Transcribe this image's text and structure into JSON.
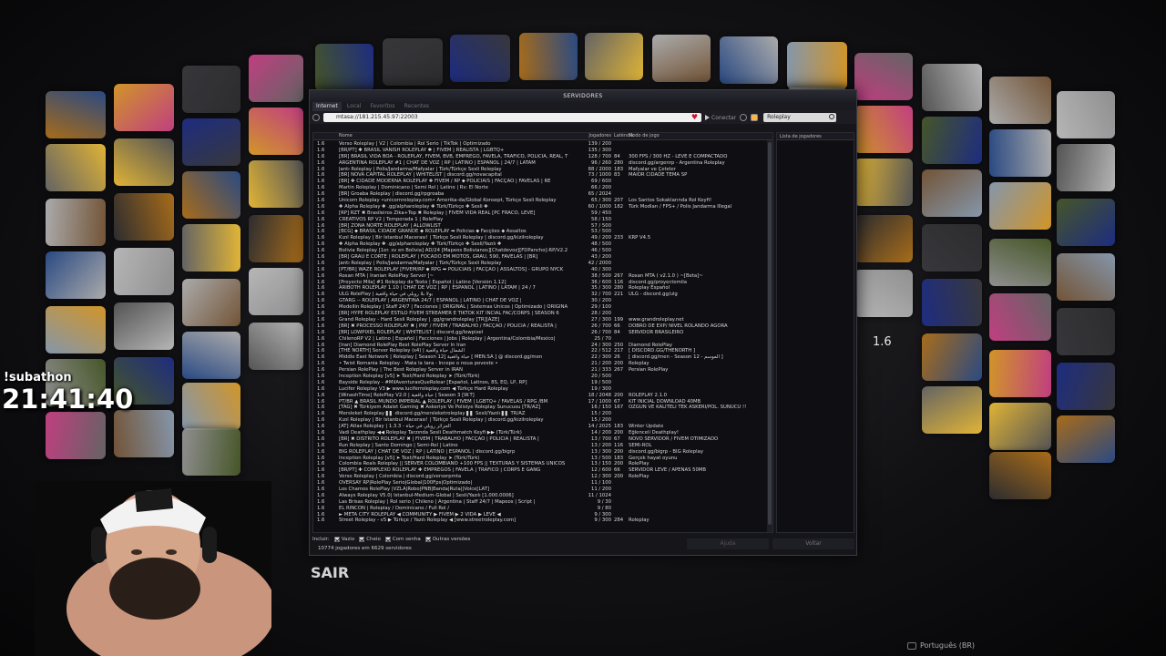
{
  "overlay": {
    "sub_label": "!subathon",
    "clock": "21:41:40",
    "exit_label": "SAIR",
    "side_version": "1.6",
    "language": "Português (BR)"
  },
  "window": {
    "title": "SERVIDORES",
    "tabs": [
      "Internet",
      "Local",
      "Favoritos",
      "Recentes"
    ],
    "address": "mtasa://181.215.45.97:22003",
    "connect_label": "Conectar",
    "search_value": "Roleplay",
    "columns": {
      "version": "",
      "name": "Nome",
      "players": "Jogadores",
      "latency": "Latência",
      "mode": "Modo de jogo"
    },
    "players_header": "Lista de jogadores",
    "filters_label": "Incluir:",
    "filters": [
      "Vazio",
      "Cheio",
      "Com senha",
      "Outras versões"
    ],
    "totals": "10774 jogadores em 6629 servidores",
    "help_label": "Ajuda",
    "back_label": "Voltar"
  },
  "servers": [
    [
      "1.6",
      "Verso Roleplay | V2 | Colombia | Rol Serio | TikTok | Optimizado",
      "139 / 200",
      "",
      ""
    ],
    [
      "1.6",
      "[BR/PT] ✱ BRASIL VANISH ROLEPLAY ✱ | FIVEM | REALISTA | LGBTQ+",
      "135 / 300",
      "",
      ""
    ],
    [
      "1.6",
      "[BR] BRASIL VIDA BOA - ROLEPLAY, FIVEM, BVB, EMPREGO, FAVELA, TRAFICO, POLICIA, REAL, T",
      "128 / 700",
      "84",
      "300 FPS / 300 HZ - LEVE E COMPACTADO"
    ],
    [
      "1.6",
      "ARGENTINA ROLEPLAY #1 | CHAT DE VOZ | RP | LATINO | ESPAÑOL | 24/7 | LATAM",
      "96 / 260",
      "280",
      "discord.gg/argenrp - Argentina Roleplay"
    ],
    [
      "1.6",
      "Jantı Roleplay | Polis/Jandarma/Mafyalar | Türk/Türkçe Sesli Roleplay",
      "88 / 2000",
      "183",
      "Mafyalar ve Çeteler"
    ],
    [
      "1.6",
      "[BR] NOVA CAPITAL ROLEPLAY | WHITELIST | discord.gg/novacapital",
      "73 / 1000",
      "83",
      "MAIOR CIDADE TEMA SP"
    ],
    [
      "1.6",
      "[BR] ✚ CIDADE MODERNA ROLEPLAY ✚ FIVEM / RP ⬥ POLICIAIS | FACÇÃO | FAVELAS | RE",
      "69 / 600",
      "",
      ""
    ],
    [
      "1.6",
      "Martin Roleplay | Dominicano | Semi Rol | Latino | Rv: El Norte",
      "66 / 200",
      "",
      ""
    ],
    [
      "1.6",
      "[BR] Groaba Roleplay | discord.gg/rpgroaba",
      "65 / 2024",
      "",
      ""
    ],
    [
      "1.6",
      "Unicorn Roleplay •unicornroleplay.com• Amerika-da/Global Konsept, Türkçe Sesli Roleplay",
      "65 / 300",
      "207",
      "Los Santos Sokaklarında Rol Keyfi!"
    ],
    [
      "1.6",
      "✚ Alpha Roleplay ✚ .gg/alpharoleplay ✚ Türk/Türkçe ✚ Sesli ✚",
      "60 / 1000",
      "182",
      "Türk Modları / FPS+ / Polis Jandarma İllegal"
    ],
    [
      "1.6",
      "[RP] RZT ✖ Brasileiros Zika+Top ✖ Roleplay | FIVEM VIDA REAL [PC FRACO, LEVE]",
      "59 / 450",
      "",
      ""
    ],
    [
      "1.6",
      "CREATIVOS RP V2 | Temporada 1 | RolePlay",
      "58 / 150",
      "",
      ""
    ],
    [
      "1.6",
      "[BR] ZONA NORTE ROLEPLAY | ALLOWLIST",
      "57 / 500",
      "",
      ""
    ],
    [
      "1.6",
      "[BCG] ⬥ BRASIL CIDADE GRANDE ⬥ ROLEPLAY ➡ Policias ⬥ Facções ⬥ Assaltos",
      "53 / 500",
      "",
      ""
    ],
    [
      "1.6",
      "Kızıl Roleplay | Bir İstanbul Macerası! | Türkçe Sesli Roleplay | discord.gg/kizilroleplay",
      "49 / 200",
      "233",
      "KRP V4.5"
    ],
    [
      "1.6",
      "✚ Alpha Roleplay ✚ .gg/alpharoleplay ✚ Türk/Türkçe ✚ Sesli/Yazılı ✚",
      "48 / 500",
      "",
      ""
    ],
    [
      "1.6",
      "Bolivia Roleplay [1er. sv en Bolivia] AD/24 [Mapeos Bolivianos][Chatdevoz][FDPancho]-RP/V2.2",
      "46 / 500",
      "",
      ""
    ],
    [
      "1.6",
      "[BR] GRAU E CORTE | ROLEPLAY | FOCADO EM MOTOS, GRAU, 590, FAVELAS | [BR]",
      "43 / 200",
      "",
      ""
    ],
    [
      "1.6",
      "Jantı Roleplay | Polis/Jandarma/Mafyalar | Türk/Türkçe Sesli Roleplay",
      "42 / 2000",
      "",
      ""
    ],
    [
      "1.6",
      "[PT/BR] WAZE ROLEPLAY [FIVEM/RP ⬥ RPG ➡ POLICIAIS | FACÇÃO | ASSALTOS] - GRUPO NYCK",
      "40 / 300",
      "",
      ""
    ],
    [
      "1.6",
      "Roxan MTA | Iranian RolePlay Server ]~",
      "38 / 500",
      "267",
      "Roxan MTA ( v2.1.0 ) ~[Beta]~"
    ],
    [
      "1.6",
      "[Proyecto Mila] #1 Roleplay de Texto | Español | Latino [Versión 1.12]",
      "36 / 600",
      "116",
      "discord.gg/proyectomila"
    ],
    [
      "1.6",
      "ARIBOTH ROLEPLAY 1.10 | CHAT DE VOZ | RP | ESPAÑOL | LATINO | LATAM | 24 / 7",
      "35 / 300",
      "280",
      "Roleplay Español"
    ],
    [
      "1.6",
      "ULG RolePlay | يولا بلا رويلي في حياة واقعية",
      "32 / 700",
      "221",
      "ULG - discord.gg/ulg"
    ],
    [
      "1.6",
      "GTARG -- ROLEPLAY | ARGENTINA 24/7 | ESPAÑOL | LATINO | CHAT DE VOZ |",
      "30 / 200",
      "",
      ""
    ],
    [
      "1.6",
      "Medellin Roleplay | Staff 24/7 | Facciones | ORIGINAL | Sistemas Unicos | Optimizado | ORIGINA",
      "29 / 100",
      "",
      ""
    ],
    [
      "1.6",
      "[BR] HYPE ROLEPLAY ESTILO FIVEM STREAMER E TIKTOK KIT INCIAL FAC/CORPS | SEASON 6",
      "28 / 200",
      "",
      ""
    ],
    [
      "1.6",
      "Grand Roleplay - Hard Sesli Roleplay | .gg/grandroleplay [TR][AZE]",
      "27 / 300",
      "199",
      "www.grandroleplay.net"
    ],
    [
      "1.6",
      "[BR] ✖ PROCESSO ROLEPLAY ✖ | PRF / FIVEM / TRABALHO / FACÇÃO / POLICIA / REALISTA |",
      "26 / 700",
      "66",
      "DOBRO DE EXP/ NIVEL ROLANDO AGORA"
    ],
    [
      "1.6",
      "[BR] LOWPIXEL ROLEPLAY | WHITELIST | discord.gg/lowpixel",
      "26 / 700",
      "84",
      "SERVIDOR BRASILEIRO"
    ],
    [
      "1.6",
      "ChilenoRP V2 | Latino | Español | Facciones | Jobs | Roleplay | Argentina/Colombia/Mexico|",
      "25 / 70",
      "",
      ""
    ],
    [
      "1.6",
      "[Iran] Diamond RolePlay Best RolePlay Server In Iran",
      "24 / 300",
      "250",
      "Diamond RolePlay"
    ],
    [
      "1.6",
      "[THE NORTH] Server Roleplay (s4) | الشمال حياة واقعية",
      "22 / 512",
      "217",
      "[ DISCORD.GG/THENORTH ]"
    ],
    [
      "1.6",
      "Middle East Network | Roleplay [ Season 12] حياة واقعية [ MEN.SA ] @ discord.gg/men",
      "22 / 300",
      "26",
      "[ discord.gg/men - Season 12 - الموسم ]"
    ],
    [
      "1.6",
      "• Twist Romania Roleplay - Mata la tara - Incepe o noua poveste •",
      "21 / 200",
      "200",
      "Roleplay"
    ],
    [
      "1.6",
      "Persian RolePlay | The Best Roleplay Server in IRAN",
      "21 / 333",
      "267",
      "Persian RolePlay"
    ],
    [
      "1.6",
      "Inception Roleplay [v5] ➤ Text/Hard Roleplay ➤ (Türk/Türk)",
      "20 / 500",
      "",
      ""
    ],
    [
      "1.6",
      "Bayside Roleplay - #MilAventurasQueRolear [Español, Latinos, 8S, EQ, LP, RP]",
      "19 / 500",
      "",
      ""
    ],
    [
      "1.6",
      "Lucifer Roleplay V3 ▶ www.luciferroleplay.com ◀ Türkçe Hard Roleplay",
      "19 / 300",
      "",
      ""
    ],
    [
      "1.6",
      "[WinashTime] RolePlay V2.0 | حياة واقعية | Season 3 [W.T]",
      "18 / 2048",
      "200",
      "ROLEPLAY 2.1.0"
    ],
    [
      "1.6",
      "PT/BR ▲ BRASIL MUNDO IMPERIAL ▲ ROLEPLAY | FIVEM | LGBTQ+ / FAVELAS / RPG /BM",
      "17 / 1000",
      "67",
      "KIT INICIAL DOWNLOAD 40MB"
    ],
    [
      "1.6",
      "[TAG] ✖ Türkiyem Adalet Gaming ✖ Askeriye Ve Polisiye Roleplay Sunucusu [TR/AZ]",
      "16 / 150",
      "167",
      "ÖZGÜN VE KALITELI TEK ASKERİ/POL. SUNUCU !!"
    ],
    [
      "1.6",
      "Mersleket Roleplay ▌▌ discord.gg/mersleketroleplay ▌▌ Sesli/Yazılı ▌▌ TR/AZ",
      "15 / 200",
      "",
      ""
    ],
    [
      "1.6",
      "Kızıl Roleplay | Bir İstanbul Macerası! | Türkçe Sesli Roleplay | discord.gg/kizilroleplay",
      "15 / 200",
      "",
      ""
    ],
    [
      "1.6",
      "[AT] Atlas Roleplay | 1.3.3 - الجزائر رويلي في حياة",
      "14 / 2025",
      "183",
      "Winter Update"
    ],
    [
      "1.6",
      "Vadi Deathplay ◀◀ Roleplay Tarzında Sesli Deathmatch Keyfi ▶▶ (Türk/Türk)",
      "14 / 200",
      "200",
      "Eğlenceli Deathplay!"
    ],
    [
      "1.6",
      "[BR] ✖ DISTRITO ROLEPLAY ✖ | FIVEM | TRABALHO | FACÇÃO | POLICIA | REALISTA |",
      "13 / 700",
      "67",
      "NOVO SERVIDOR / FIVEM OTIMIZADO"
    ],
    [
      "1.6",
      "Run Roleplay | Santo Domingo | Semi-Rol | Latino",
      "13 / 200",
      "116",
      "SEMI-ROL"
    ],
    [
      "1.6",
      "BIG ROLEPLAY | CHAT DE VOZ | RP | LATINO | ESPAÑOL | discord.gg/bigrp",
      "13 / 300",
      "200",
      "discord.gg/bigrp - BIG Roleplay"
    ],
    [
      "1.6",
      "Inception Roleplay [v5] ➤ Text/Hard Roleplay ➤ (Türk/Türk)",
      "13 / 500",
      "183",
      "Gerçek hayat oyunu"
    ],
    [
      "1.6",
      "Colombia Reals Roleplay || SERVER COLOMBIANO +100 FPS || TEXTURAS Y SISTEMAS UNICOS",
      "13 / 150",
      "200",
      "RolePlay"
    ],
    [
      "1.6",
      "[BR/PT] ✚ COMPLEXO ROLEPLAY ✚ EMPREGOS | FAVELA | TRAFICO | CORPS E GANG",
      "12 / 600",
      "66",
      "SERVIDOR LEVE / APENAS 50MB"
    ],
    [
      "1.6",
      "Verso Roleplay | Colombia | discord.gg/versorpmta",
      "12 / 300",
      "200",
      "RolePlay"
    ],
    [
      "1.6",
      "OVERSAY RP|RolePlay Serio|Global|100Fps|Optimizado|",
      "11 / 100",
      "",
      ""
    ],
    [
      "1.6",
      "Los Chamos RolePlay |VZLA|Robo|PNB|Banda|Ruta||Voice[LAT]",
      "11 / 200",
      "",
      ""
    ],
    [
      "1.6",
      "Always Roleplay V5.0| İstanbul-Medium-Global | Sesli/Yazılı [1.000.0006]",
      "11 / 1024",
      "",
      ""
    ],
    [
      "1.6",
      "Las Brisas Roleplay | Rol serio | Chileno | Argentina | Staff 24/7 | Mapeos | Script |",
      "9 / 30",
      "",
      ""
    ],
    [
      "1.6",
      "EL RINCON | Roleplay / Dominicano / Full Rol /",
      "9 / 80",
      "",
      ""
    ],
    [
      "1.6",
      "► META CITY ROLEPLAY ◀ COMMUNITY ▶ FIVEM ▶ 2 VIDA ▶ LEVE ◀",
      "9 / 300",
      "",
      ""
    ],
    [
      "1.6",
      "Street Roleplay - v5 ▶ Türkçe / Yazılı Roleplay ◀ [www.streetroleplay.com]",
      "9 / 300",
      "284",
      "Roleplay"
    ]
  ]
}
